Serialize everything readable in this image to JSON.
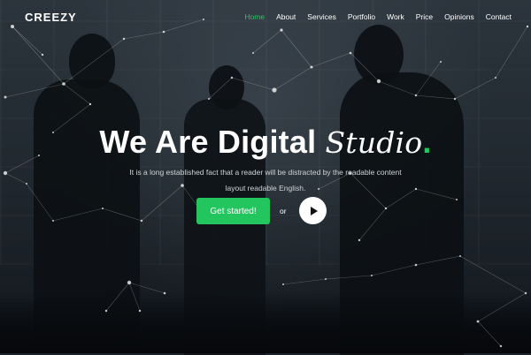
{
  "brand": {
    "logo_text": "CREEZY"
  },
  "nav": {
    "items": [
      {
        "label": "Home",
        "active": true
      },
      {
        "label": "About",
        "active": false
      },
      {
        "label": "Services",
        "active": false
      },
      {
        "label": "Portfolio",
        "active": false
      },
      {
        "label": "Work",
        "active": false
      },
      {
        "label": "Price",
        "active": false
      },
      {
        "label": "Opinions",
        "active": false
      },
      {
        "label": "Contact",
        "active": false
      }
    ]
  },
  "hero": {
    "title_main": "We Are Digital ",
    "title_accent": "Studio",
    "title_dot": ".",
    "subtitle": "It is a long established fact that a reader will be distracted by the readable content layout readable English.",
    "cta_label": "Get started!",
    "or_text": "or",
    "play_icon": "play-icon"
  },
  "colors": {
    "accent": "#22c55e",
    "text": "#ffffff",
    "subtext": "#cfd4d8",
    "overlay": "#1b2228"
  }
}
